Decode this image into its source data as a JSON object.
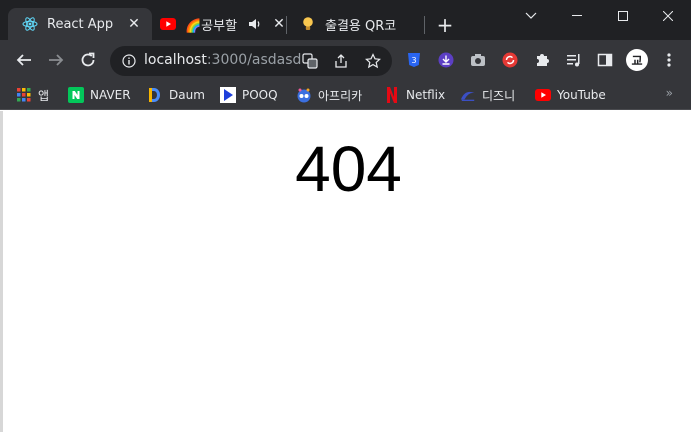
{
  "tabs": [
    {
      "title": "React App",
      "active": true,
      "favicon": "react-icon"
    },
    {
      "title": "🌈공부할",
      "active": false,
      "favicon": "youtube-icon",
      "audio": true
    },
    {
      "title": "출결용 QR코",
      "active": false,
      "favicon": "lightbulb-icon"
    }
  ],
  "address": {
    "host": "localhost",
    "path": ":3000/asdasd"
  },
  "bookmarks": [
    {
      "label": "앱",
      "icon": "apps-grid-icon"
    },
    {
      "label": "NAVER",
      "icon": "naver-icon"
    },
    {
      "label": "Daum",
      "icon": "daum-icon"
    },
    {
      "label": "POOQ",
      "icon": "pooq-icon"
    },
    {
      "label": "아프리카",
      "icon": "afreeca-icon"
    },
    {
      "label": "Netflix",
      "icon": "netflix-icon"
    },
    {
      "label": "디즈니",
      "icon": "disney-icon"
    },
    {
      "label": "YouTube",
      "icon": "youtube-icon"
    }
  ],
  "bookmarks_more": "»",
  "profile_initial": "교",
  "page": {
    "message": "404"
  },
  "colors": {
    "titlebar": "#202124",
    "toolbar": "#35363a",
    "youtube_red": "#ff0000",
    "naver_green": "#03c75a"
  }
}
